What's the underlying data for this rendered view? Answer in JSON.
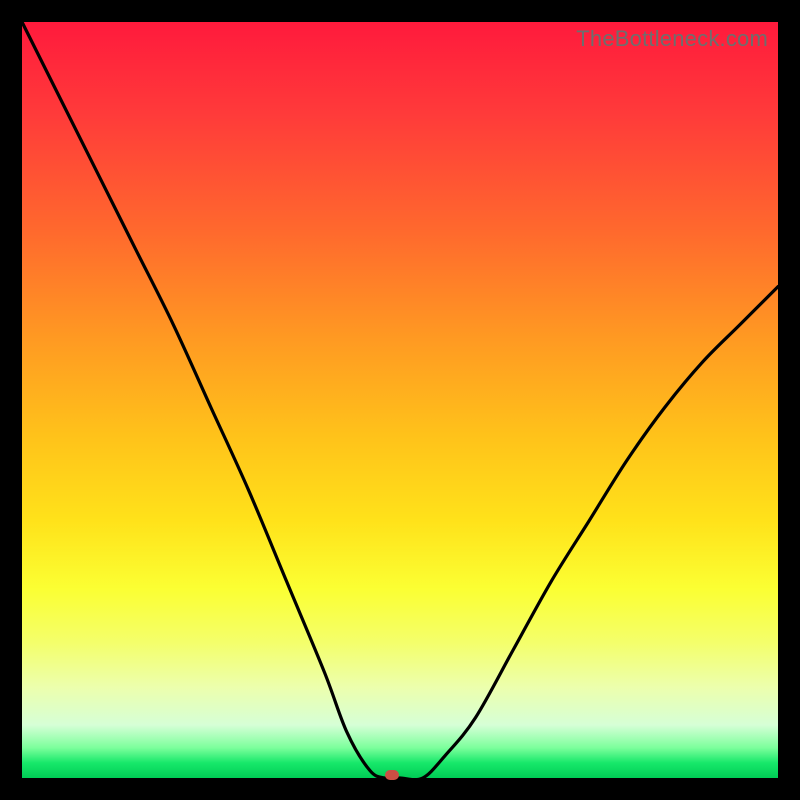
{
  "watermark": "TheBottleneck.com",
  "chart_data": {
    "type": "line",
    "title": "",
    "xlabel": "",
    "ylabel": "",
    "xlim": [
      0,
      100
    ],
    "ylim": [
      0,
      100
    ],
    "x": [
      0,
      5,
      10,
      15,
      20,
      25,
      30,
      35,
      40,
      43,
      46,
      48,
      50,
      53,
      56,
      60,
      65,
      70,
      75,
      80,
      85,
      90,
      95,
      100
    ],
    "values": [
      100,
      90,
      80,
      70,
      60,
      49,
      38,
      26,
      14,
      6,
      1,
      0,
      0,
      0,
      3,
      8,
      17,
      26,
      34,
      42,
      49,
      55,
      60,
      65
    ],
    "minimum_x": 49,
    "gradient_stops": [
      {
        "pos": 0.0,
        "color": "#ff1a3c"
      },
      {
        "pos": 0.5,
        "color": "#ffc31a"
      },
      {
        "pos": 0.8,
        "color": "#fbff55"
      },
      {
        "pos": 1.0,
        "color": "#00cc55"
      }
    ]
  },
  "marker": {
    "x_pct": 49,
    "y_pct": 0
  }
}
